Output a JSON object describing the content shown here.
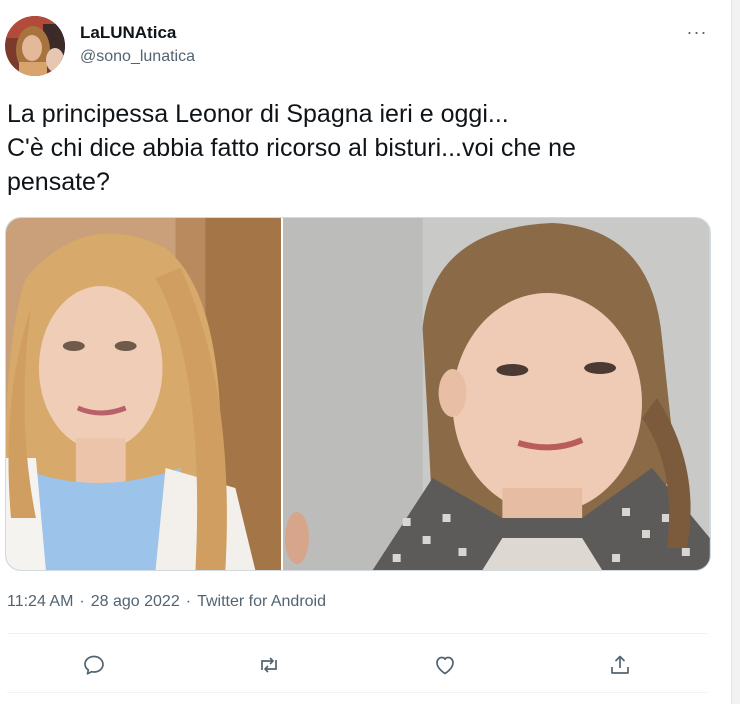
{
  "tweet": {
    "author": {
      "name": "LaLUNAtica",
      "handle": "@sono_lunatica"
    },
    "text_lines": [
      "La principessa Leonor di Spagna ieri e oggi...",
      "C'è chi dice abbia fatto ricorso al bisturi...voi che ne",
      "pensate?"
    ],
    "media": [
      {
        "description": "photo-left"
      },
      {
        "description": "photo-right"
      }
    ],
    "meta": {
      "time": "11:24 AM",
      "separator": "·",
      "date": "28 ago 2022",
      "source": "Twitter for Android"
    },
    "actions": [
      {
        "icon": "reply-icon"
      },
      {
        "icon": "retweet-icon"
      },
      {
        "icon": "like-icon"
      },
      {
        "icon": "share-icon"
      }
    ],
    "more_label": "···"
  },
  "colors": {
    "text_primary": "#0f1419",
    "text_secondary": "#536471",
    "border": "#cfd9de"
  }
}
